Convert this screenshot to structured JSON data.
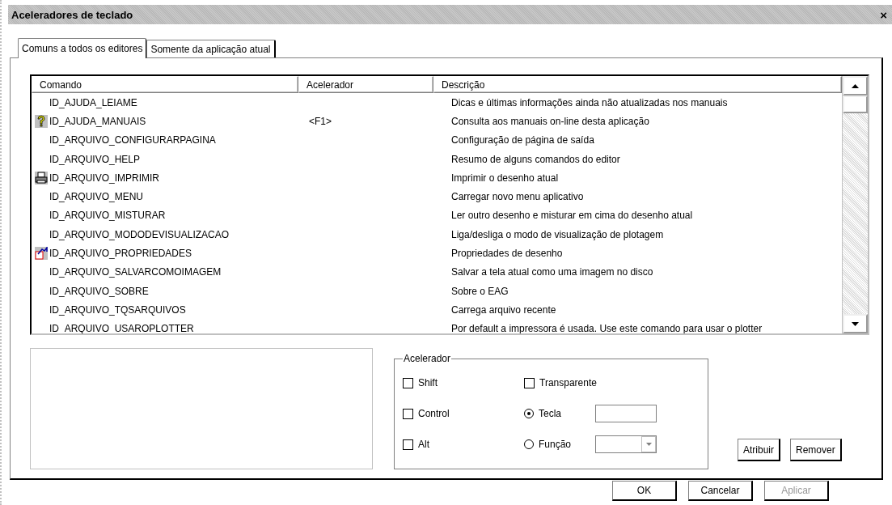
{
  "window": {
    "title": "Aceleradores de teclado",
    "close": "×"
  },
  "tabs": [
    {
      "label": "Comuns a todos os editores",
      "selected": true
    },
    {
      "label": "Somente da aplicação atual",
      "selected": false
    }
  ],
  "table": {
    "columns": [
      "Comando",
      "Acelerador",
      "Descrição"
    ],
    "rows": [
      {
        "kind": "plain",
        "command": "ID_AJUDA_LEIAME",
        "accelerator": "",
        "description": "Dicas e últimas informações ainda não atualizadas nos manuais"
      },
      {
        "kind": "help",
        "command": "ID_AJUDA_MANUAIS",
        "accelerator": "<F1>",
        "description": "Consulta aos manuais on-line desta aplicação"
      },
      {
        "kind": "plain",
        "command": "ID_ARQUIVO_CONFIGURARPAGINA",
        "accelerator": "",
        "description": "Configuração de página de saída"
      },
      {
        "kind": "plain",
        "command": "ID_ARQUIVO_HELP",
        "accelerator": "",
        "description": "Resumo de alguns comandos do editor"
      },
      {
        "kind": "print",
        "command": "ID_ARQUIVO_IMPRIMIR",
        "accelerator": "",
        "description": "Imprimir o desenho atual"
      },
      {
        "kind": "plain",
        "command": "ID_ARQUIVO_MENU",
        "accelerator": "",
        "description": "Carregar novo menu aplicativo"
      },
      {
        "kind": "plain",
        "command": "ID_ARQUIVO_MISTURAR",
        "accelerator": "",
        "description": "Ler outro desenho e misturar em cima do desenho atual"
      },
      {
        "kind": "plain",
        "command": "ID_ARQUIVO_MODODEVISUALIZACAO",
        "accelerator": "",
        "description": "Liga/desliga o modo de visualização de plotagem"
      },
      {
        "kind": "properties",
        "command": "ID_ARQUIVO_PROPRIEDADES",
        "accelerator": "",
        "description": "Propriedades de desenho"
      },
      {
        "kind": "plain",
        "command": "ID_ARQUIVO_SALVARCOMOIMAGEM",
        "accelerator": "",
        "description": "Salvar a tela atual como uma imagem no disco"
      },
      {
        "kind": "plain",
        "command": "ID_ARQUIVO_SOBRE",
        "accelerator": "",
        "description": "Sobre o EAG"
      },
      {
        "kind": "plain",
        "command": "ID_ARQUIVO_TQSARQUIVOS",
        "accelerator": "",
        "description": "Carrega arquivo recente"
      },
      {
        "kind": "plain",
        "command": "ID_ARQUIVO_USAROPLOTTER",
        "accelerator": "",
        "description": "Por default a impressora é usada. Use este comando para usar o plotter"
      }
    ]
  },
  "accelerator": {
    "title": "Acelerador",
    "modifiers": [
      {
        "label": "Shift",
        "checked": false
      },
      {
        "label": "Control",
        "checked": false
      },
      {
        "label": "Alt",
        "checked": false
      }
    ],
    "transparent": {
      "label": "Transparente",
      "checked": false
    },
    "options": [
      {
        "label": "Tecla",
        "selected": true
      },
      {
        "label": "Função",
        "selected": false
      }
    ]
  },
  "side_buttons": [
    {
      "label": "Atribuir",
      "disabled": false
    },
    {
      "label": "Remover",
      "disabled": false
    }
  ],
  "buttons": [
    {
      "label": "OK",
      "disabled": false
    },
    {
      "label": "Cancelar",
      "disabled": false
    },
    {
      "label": "Aplicar",
      "disabled": true
    }
  ]
}
